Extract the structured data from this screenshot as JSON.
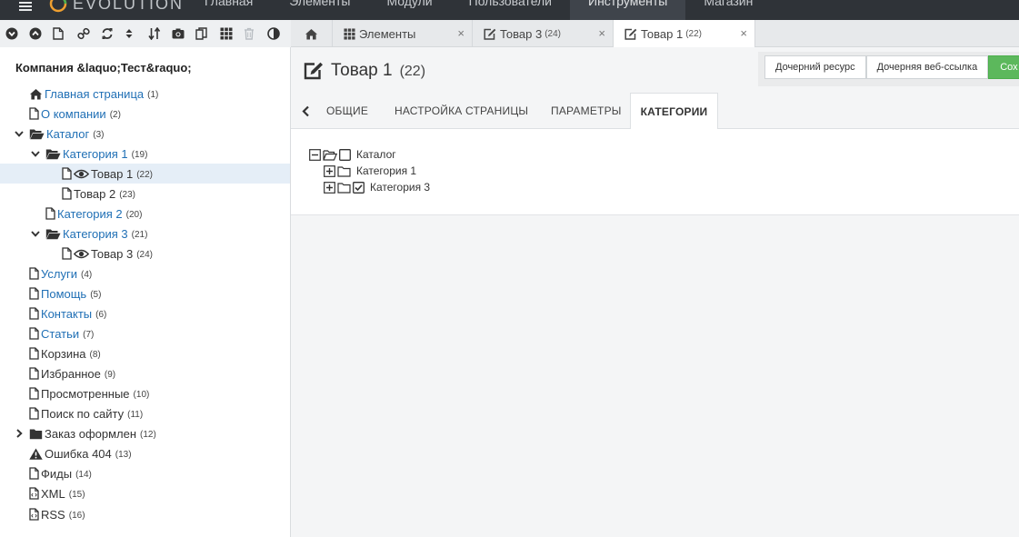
{
  "app": {
    "logo_text": "EVOLUTION"
  },
  "topnav": [
    "Главная",
    "Элементы",
    "Модули",
    "Пользователи",
    "Инструменты",
    "Магазин"
  ],
  "topnav_active": "Инструменты",
  "toolbar_icons": [
    "expand-tree-icon",
    "collapse-tree-icon",
    "new-document-icon",
    "new-weblink-icon",
    "refresh-icon",
    "sort-icon",
    "sort-order-icon",
    "media-icon",
    "files-icon",
    "elements-grid-icon",
    "trash-icon",
    "theme-toggle-icon"
  ],
  "tabs": [
    {
      "label": "",
      "icon": "home-icon"
    },
    {
      "label": "Элементы",
      "count": "",
      "icon": "grid-icon"
    },
    {
      "label": "Товар 3",
      "count": "(24)",
      "icon": "edit-icon"
    },
    {
      "label": "Товар 1",
      "count": "(22)",
      "icon": "edit-icon"
    }
  ],
  "tab_close_glyph": "×",
  "sidebar": {
    "site_name": "Компания &laquo;Тест&raquo;",
    "tree": [
      {
        "label": "Главная страница",
        "count": "(1)",
        "icon": "home-icon",
        "link": true
      },
      {
        "label": "О компании",
        "count": "(2)",
        "icon": "file-icon",
        "link": true
      },
      {
        "label": "Каталог",
        "count": "(3)",
        "icon": "folder-open-icon",
        "link": true
      },
      {
        "label": "Категория 1",
        "count": "(19)",
        "icon": "folder-open-icon",
        "link": true
      },
      {
        "label": "Товар 1",
        "count": "(22)",
        "icon": "file-icon",
        "link": false
      },
      {
        "label": "Товар 2",
        "count": "(23)",
        "icon": "file-icon",
        "link": false
      },
      {
        "label": "Категория 2",
        "count": "(20)",
        "icon": "file-icon",
        "link": true
      },
      {
        "label": "Категория 3",
        "count": "(21)",
        "icon": "folder-open-icon",
        "link": true
      },
      {
        "label": "Товар 3",
        "count": "(24)",
        "icon": "file-icon",
        "link": false
      },
      {
        "label": "Услуги",
        "count": "(4)",
        "icon": "file-icon",
        "link": true
      },
      {
        "label": "Помощь",
        "count": "(5)",
        "icon": "file-icon",
        "link": true
      },
      {
        "label": "Контакты",
        "count": "(6)",
        "icon": "file-icon",
        "link": true
      },
      {
        "label": "Статьи",
        "count": "(7)",
        "icon": "file-icon",
        "link": true
      },
      {
        "label": "Корзина",
        "count": "(8)",
        "icon": "file-icon",
        "link": false
      },
      {
        "label": "Избранное",
        "count": "(9)",
        "icon": "file-icon",
        "link": false
      },
      {
        "label": "Просмотренные",
        "count": "(10)",
        "icon": "file-icon",
        "link": false
      },
      {
        "label": "Поиск по сайту",
        "count": "(11)",
        "icon": "file-icon",
        "link": false
      },
      {
        "label": "Заказ оформлен",
        "count": "(12)",
        "icon": "folder-icon",
        "link": false
      },
      {
        "label": "Ошибка 404",
        "count": "(13)",
        "icon": "warning-icon",
        "link": false
      },
      {
        "label": "Фиды",
        "count": "(14)",
        "icon": "file-icon",
        "link": false
      },
      {
        "label": "XML",
        "count": "(15)",
        "icon": "file-code-icon",
        "link": false
      },
      {
        "label": "RSS",
        "count": "(16)",
        "icon": "file-code-icon",
        "link": false
      }
    ]
  },
  "document": {
    "title": "Товар 1",
    "count": "(22)"
  },
  "actions": [
    {
      "label": "Дочерний ресурс"
    },
    {
      "label": "Дочерняя веб-ссылка"
    },
    {
      "label": "Сох"
    }
  ],
  "page_tabs": [
    "ОБЩИЕ",
    "НАСТРОЙКА СТРАНИЦЫ",
    "ПАРАМЕТРЫ",
    "КАТЕГОРИИ"
  ],
  "page_tabs_active": "КАТЕГОРИИ",
  "categories_tree": [
    {
      "label": "Каталог",
      "checked": false,
      "expanded": true
    },
    {
      "label": "Категория 1",
      "checked": false,
      "expanded": false
    },
    {
      "label": "Категория 3",
      "checked": true,
      "expanded": false
    }
  ],
  "colors": {
    "topbar": "#2f3338",
    "link": "#1f6fb5",
    "save_green": "#5cb85c",
    "selected_row": "#e5eef7"
  }
}
